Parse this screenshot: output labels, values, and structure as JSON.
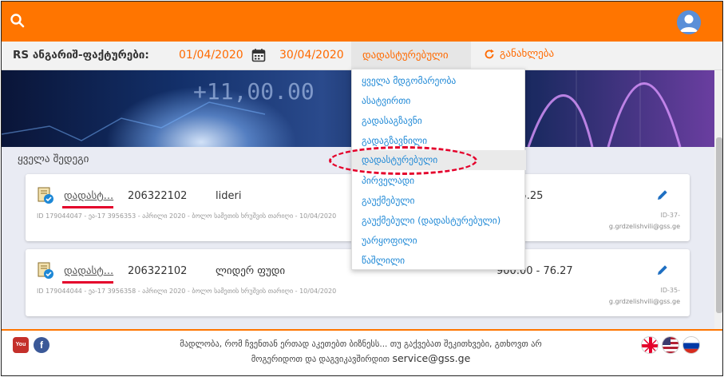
{
  "header": {
    "search_icon": "search-icon",
    "avatar_icon": "user-avatar-icon",
    "colors": {
      "bar": "#ff7500"
    }
  },
  "filter": {
    "title": "RS ანგარიშ-ფაქტურები:",
    "date_from": "01/04/2020",
    "date_to": "30/04/2020",
    "status_selected": "დადასტურებული",
    "refresh_label": "განახლება"
  },
  "banner": {
    "ticker": "+11,00.00"
  },
  "results": {
    "title": "ყველა შედეგი",
    "rows": [
      {
        "status": "დადასტ...",
        "tin": "206322102",
        "company": "lideri",
        "meta": "ID 179044047 - ეა-17 3956353 - აპრილი 2020 - ბოლო სამეთის ხრუშვის თარიღი - 10/04/2020",
        "amount": "0 - 15.25",
        "id_right": "ID-37-",
        "user": "g.grdzelishvili@gss.ge"
      },
      {
        "status": "დადასტ...",
        "tin": "206322102",
        "company": "ლიდერ ფუდი",
        "meta": "ID 179044044 - ეა-17 3956358 - აპრილი 2020 - ბოლო სამეთის ხრუშვის თარიღი - 10/04/2020",
        "amount": "900.00 - 76.27",
        "id_right": "ID-35-",
        "user": "g.grdzelishvili@gss.ge"
      }
    ]
  },
  "dropdown": {
    "options": [
      "ყველა მდგომარეობა",
      "ასატვირთი",
      "გადასაგზავნი",
      "გადაგზავნილი",
      "დადასტურებული",
      "პირველადი",
      "გაუქმებული",
      "გაუქმებული (დადასტურებული)",
      "უარყოფილი",
      "წაშლილი"
    ],
    "selected_index": 4
  },
  "footer": {
    "message_line1": "მადლობა, რომ ჩვენთან ერთად აკეთებთ ბიზნესს... თუ გაქვებათ შეკითხვები, გთხოვთ არ",
    "message_line2": "მოგერიდოთ და დაგვიკავშირდით",
    "email": "service@gss.ge",
    "social": {
      "youtube": "You",
      "facebook": "f"
    }
  }
}
